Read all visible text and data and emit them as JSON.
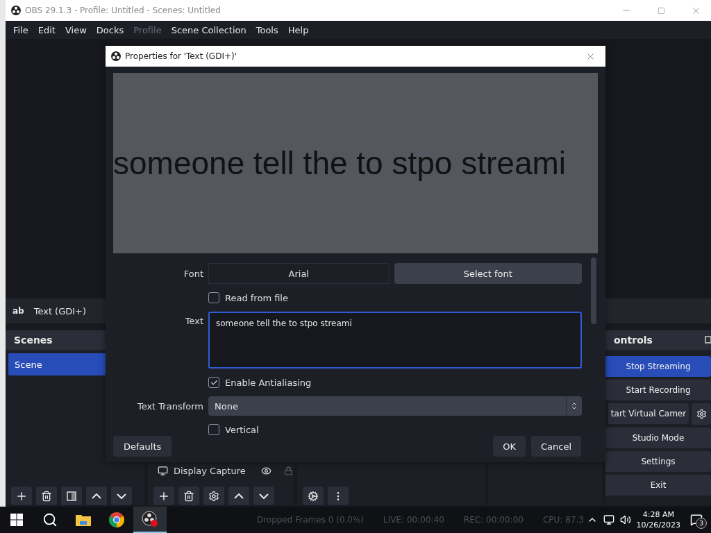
{
  "window": {
    "title": "OBS 29.1.3 - Profile: Untitled - Scenes: Untitled"
  },
  "menu": [
    {
      "label": "File",
      "disabled": false
    },
    {
      "label": "Edit",
      "disabled": false
    },
    {
      "label": "View",
      "disabled": false
    },
    {
      "label": "Docks",
      "disabled": false
    },
    {
      "label": "Profile",
      "disabled": true
    },
    {
      "label": "Scene Collection",
      "disabled": false
    },
    {
      "label": "Tools",
      "disabled": false
    },
    {
      "label": "Help",
      "disabled": false
    }
  ],
  "source_bar": {
    "icon_text": "ab",
    "label": "Text (GDI+)"
  },
  "scenes": {
    "title": "Scenes",
    "items": [
      {
        "label": "Scene",
        "selected": true
      }
    ]
  },
  "sources": {
    "items": [
      {
        "label": "Display Capture"
      }
    ]
  },
  "controls": {
    "title": "ontrols",
    "buttons": [
      {
        "label": "Stop Streaming",
        "active": true,
        "kind": "plain"
      },
      {
        "label": "Start Recording",
        "active": false,
        "kind": "plain"
      },
      {
        "label": "tart Virtual Camer",
        "active": false,
        "kind": "split"
      },
      {
        "label": "Studio Mode",
        "active": false,
        "kind": "plain"
      },
      {
        "label": "Settings",
        "active": false,
        "kind": "plain"
      },
      {
        "label": "Exit",
        "active": false,
        "kind": "plain"
      }
    ]
  },
  "dialog": {
    "title": "Properties for 'Text (GDI+)'",
    "preview_text": "someone tell the to stpo streami",
    "rows": [
      {
        "kind": "font",
        "label": "Font",
        "value": "Arial",
        "button": "Select font"
      },
      {
        "kind": "checkbox",
        "label": "Read from file",
        "checked": false
      },
      {
        "kind": "textarea",
        "label": "Text",
        "value": "someone tell the to stpo streami"
      },
      {
        "kind": "checkbox",
        "label": "Enable Antialiasing",
        "checked": true
      },
      {
        "kind": "select",
        "label": "Text Transform",
        "value": "None"
      },
      {
        "kind": "checkbox",
        "label": "Vertical",
        "checked": false
      }
    ],
    "defaults_button": "Defaults",
    "ok_button": "OK",
    "cancel_button": "Cancel"
  },
  "status_bar": [
    "Dropped Frames 0 (0.0%)",
    "LIVE: 00:00:40",
    "REC: 00:00:00",
    "CPU: 87.3"
  ],
  "taskbar": {
    "time": "4:28 AM",
    "date": "10/26/2023",
    "notifications": "3"
  }
}
